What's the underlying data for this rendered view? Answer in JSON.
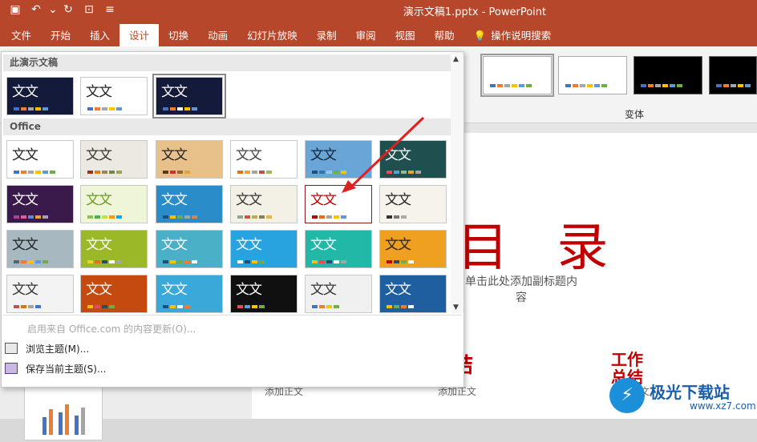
{
  "window": {
    "title": "演示文稿1.pptx  -  PowerPoint"
  },
  "quick_access": [
    {
      "name": "save-icon",
      "glyph": "▣"
    },
    {
      "name": "undo-icon",
      "glyph": "↶"
    },
    {
      "name": "undo-dropdown-icon",
      "glyph": "⌄"
    },
    {
      "name": "redo-icon",
      "glyph": "↻"
    },
    {
      "name": "start-slideshow-icon",
      "glyph": "⊡"
    },
    {
      "name": "customize-qat-icon",
      "glyph": "≡"
    }
  ],
  "tabs": [
    "文件",
    "开始",
    "插入",
    "设计",
    "切换",
    "动画",
    "幻灯片放映",
    "录制",
    "审阅",
    "视图",
    "帮助"
  ],
  "active_tab": "设计",
  "tell_me": "操作说明搜索",
  "variants": {
    "label": "变体"
  },
  "gallery": {
    "section_current": "此演示文稿",
    "section_office": "Office",
    "theme_glyph": "文文",
    "menu": {
      "update": "启用来自 Office.com 的内容更新(O)...",
      "browse": "浏览主题(M)...",
      "save": "保存当前主题(S)..."
    }
  },
  "slide": {
    "title": "目 录",
    "subtitle": "单击此处添加副标题内容",
    "red_label_1": "结",
    "red_label_2": "工作总结",
    "body_1": "添加正文",
    "body_2": "添加正文",
    "body_3": "添加正文"
  },
  "watermark": {
    "logo": "⚡",
    "text": "极光下载站",
    "url": "www.xz7.com"
  },
  "colors": {
    "accent": "#b7472a",
    "slide_red": "#c00000"
  }
}
